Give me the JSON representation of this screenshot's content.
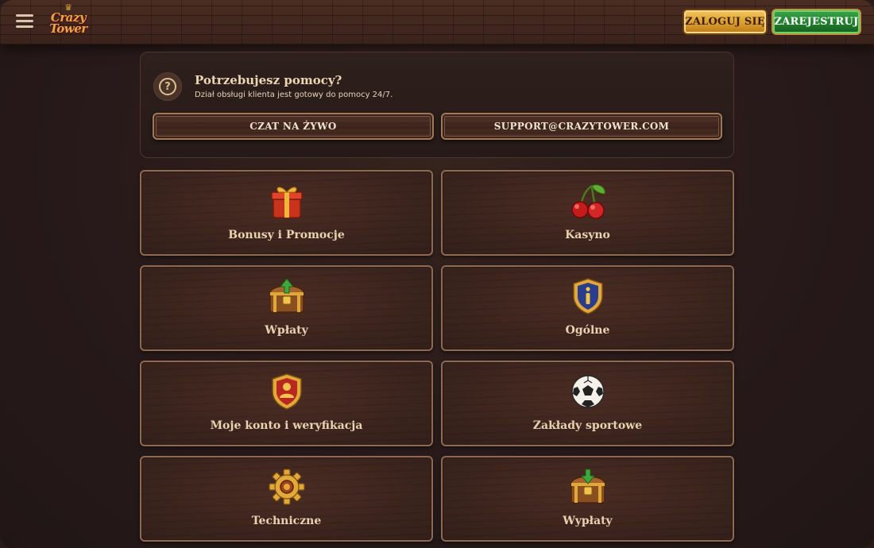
{
  "header": {
    "logo_line1": "Crazy",
    "logo_line2": "Tower",
    "login_label": "ZALOGUJ SIĘ",
    "register_label": "ZAREJESTRUJ"
  },
  "help": {
    "title": "Potrzebujesz pomocy?",
    "subtitle": "Dział obsługi klienta jest gotowy do pomocy 24/7.",
    "chat_label": "CZAT NA ŻYWO",
    "email_label": "SUPPORT@CRAZYTOWER.COM"
  },
  "categories": [
    {
      "label": "Bonusy i Promocje",
      "icon": "gift-icon"
    },
    {
      "label": "Kasyno",
      "icon": "cherries-icon"
    },
    {
      "label": "Wpłaty",
      "icon": "treasure-chest-deposit-icon"
    },
    {
      "label": "Ogólne",
      "icon": "info-shield-icon"
    },
    {
      "label": "Moje konto i weryfikacja",
      "icon": "user-shield-icon"
    },
    {
      "label": "Zakłady sportowe",
      "icon": "soccer-ball-icon"
    },
    {
      "label": "Techniczne",
      "icon": "gear-icon"
    },
    {
      "label": "Wypłaty",
      "icon": "treasure-chest-withdraw-icon"
    }
  ],
  "colors": {
    "background": "#2a1b18",
    "gold": "#e2a94a",
    "green": "#1f7a2a",
    "text": "#e9d2b0"
  }
}
